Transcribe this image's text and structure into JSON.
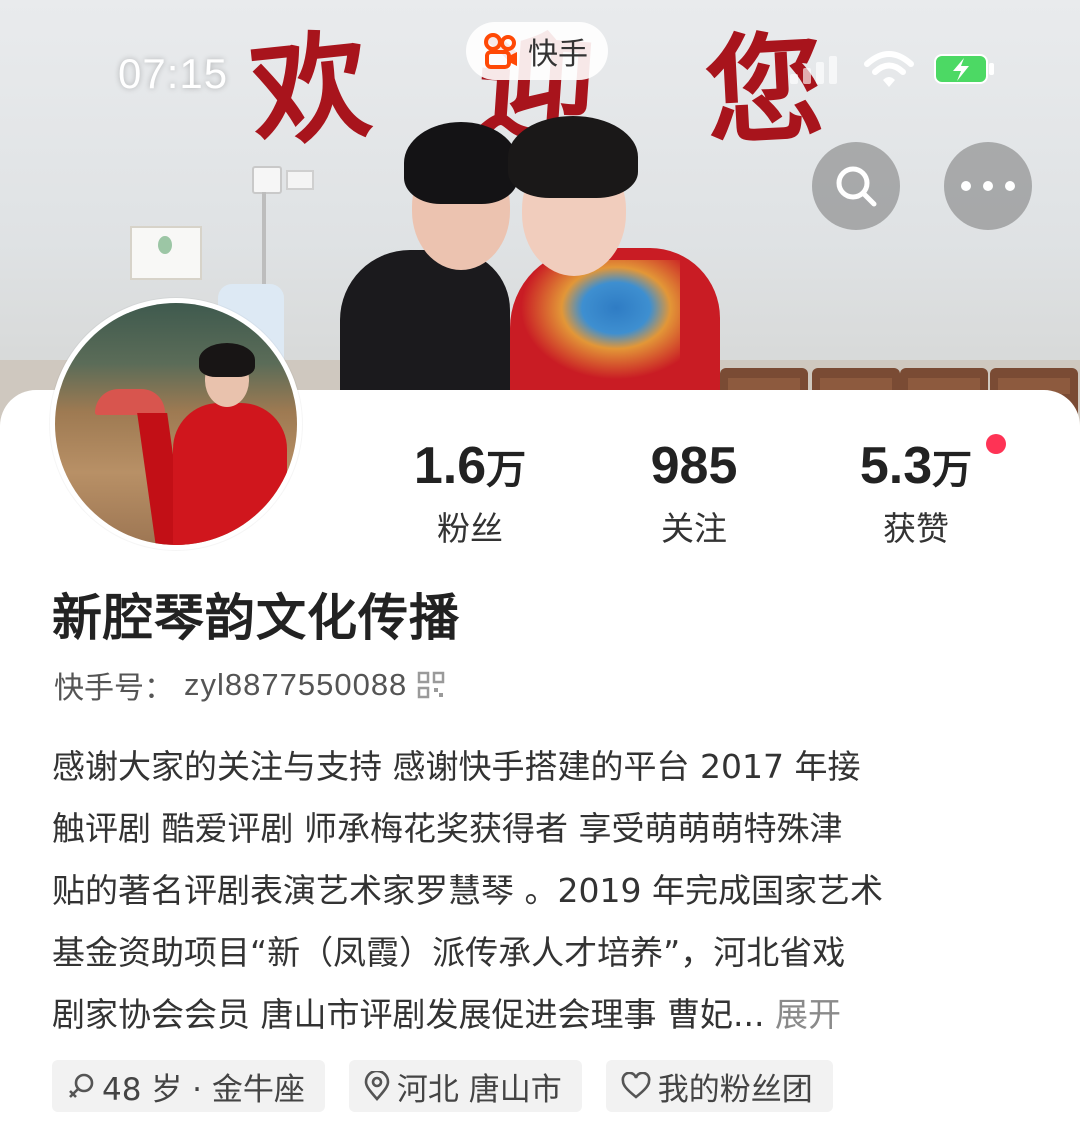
{
  "status_bar": {
    "time": "07:15"
  },
  "app": {
    "name": "快手",
    "brand_color": "#ff4906"
  },
  "cover": {
    "banner_chars": [
      "欢",
      "迎",
      "您"
    ]
  },
  "profile": {
    "stats": [
      {
        "value": "1.6",
        "unit": "万",
        "label": "粉丝"
      },
      {
        "value": "985",
        "unit": "",
        "label": "关注"
      },
      {
        "value": "5.3",
        "unit": "万",
        "label": "获赞"
      }
    ],
    "likes_badge_color": "#fe3355",
    "name": "新腔琴韵文化传播",
    "kuaishou_id_label": "快手号：",
    "kuaishou_id": "zyl8877550088",
    "bio_lines": [
      "感谢大家的关注与支持  感谢快手搭建的平台   2017 年接",
      "触评剧  酷爱评剧   师承梅花奖获得者 享受萌萌萌特殊津",
      "贴的著名评剧表演艺术家罗慧琴 。2019 年完成国家艺术",
      "基金资助项目“新（凤霞）派传承人才培养”，河北省戏",
      "剧家协会会员   唐山市评剧发展促进会理事   曹妃..."
    ],
    "bio_expand": "展开",
    "tags": [
      {
        "icon": "gender-icon",
        "label": "48 岁 · 金牛座"
      },
      {
        "icon": "location-icon",
        "label": "河北 唐山市"
      },
      {
        "icon": "heart-icon",
        "label": "我的粉丝团"
      }
    ]
  }
}
